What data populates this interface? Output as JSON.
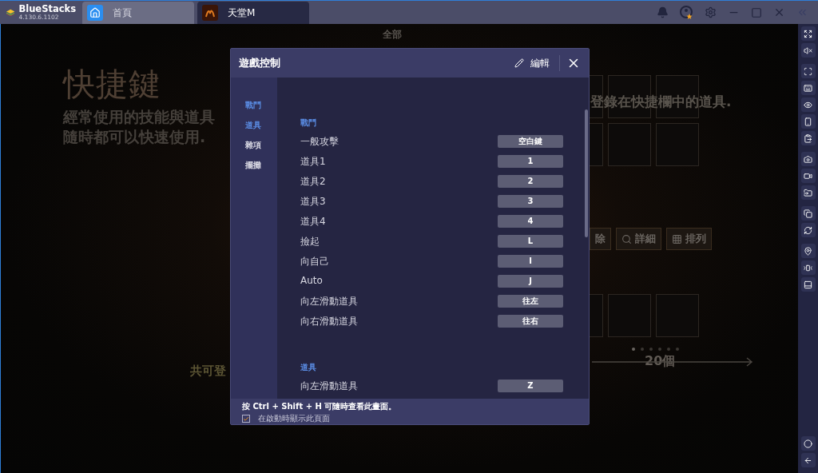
{
  "titlebar": {
    "app_name": "BlueStacks",
    "version": "4.130.6.1102",
    "tabs": [
      {
        "label": "首頁",
        "selected": false,
        "kind": "home"
      },
      {
        "label": "天堂M",
        "selected": true,
        "kind": "game"
      }
    ]
  },
  "game_background": {
    "top_tab": "全部",
    "title": "快捷鍵",
    "subtitle_lines": [
      "經常使用的技能與道具",
      "隨時都可以快速使用."
    ],
    "hint": "登錄在快捷欄中的道具.",
    "partial_button": "除",
    "buttons": [
      "詳細",
      "排列"
    ],
    "count_label": "共可登",
    "count": "20個"
  },
  "dialog": {
    "title": "遊戲控制",
    "edit_label": "編輯",
    "nav": [
      {
        "label": "戰鬥",
        "selected": true
      },
      {
        "label": "道具",
        "selected": true
      },
      {
        "label": "雜項",
        "selected": false
      },
      {
        "label": "擺攤",
        "selected": false
      }
    ],
    "sections": [
      {
        "heading": "戰鬥",
        "bindings": [
          {
            "action": "一般攻擊",
            "key": "空白鍵"
          },
          {
            "action": "道具1",
            "key": "1"
          },
          {
            "action": "道具2",
            "key": "2"
          },
          {
            "action": "道具3",
            "key": "3"
          },
          {
            "action": "道具4",
            "key": "4"
          },
          {
            "action": "撿起",
            "key": "L"
          },
          {
            "action": "向自己",
            "key": "I"
          },
          {
            "action": "Auto",
            "key": "J"
          },
          {
            "action": "向左滑動道具",
            "key": "往左"
          },
          {
            "action": "向右滑動道具",
            "key": "往右"
          }
        ]
      },
      {
        "heading": "道具",
        "bindings": [
          {
            "action": "向左滑動道具",
            "key": "Z"
          }
        ]
      }
    ],
    "footer": {
      "hint": "按 Ctrl + Shift + H 可隨時查看此畫面。",
      "show_on_start": {
        "label": "在啟動時顯示此頁面",
        "checked": true
      }
    }
  }
}
